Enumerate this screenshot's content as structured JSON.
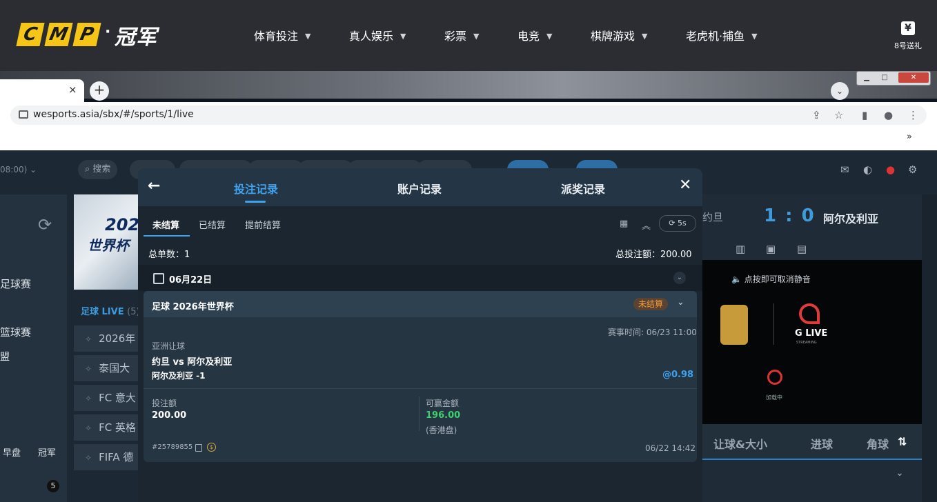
{
  "site": {
    "logo_letters": [
      "C",
      "M",
      "P"
    ],
    "logo_cn": "冠军",
    "nav": [
      "体育投注",
      "真人娱乐",
      "彩票",
      "电竞",
      "棋牌游戏",
      "老虎机·捕鱼"
    ],
    "gift_icon": "yen-gift-icon",
    "gift_label": "8号送礼"
  },
  "browser": {
    "url": "wesports.asia/sbx/#/sports/1/live",
    "tab_close": "×",
    "new_tab": "+",
    "bookmarks_more": "»"
  },
  "page": {
    "timezone": "08:00)",
    "toolbar": [
      "搜索"
    ],
    "left_items": [
      "足球赛",
      "篮球赛",
      "盟"
    ],
    "left_bottom": [
      "早盘",
      "冠军"
    ],
    "left_count": "5",
    "banner_text": [
      "202",
      "世界杯"
    ],
    "live_label": "足球 LIVE",
    "live_count": "(5)",
    "matches": [
      "2026年",
      "泰国大",
      "FC 意大",
      "FC 英格",
      "FIFA 德"
    ],
    "score_home": "约旦",
    "score": "1 : 0",
    "score_away": "阿尔及利亚",
    "mute_text": "点按即可取消静音",
    "brand_text": "G LIVE",
    "brand_sub": "STREAMING",
    "loading": "加载中",
    "bet_tabs": [
      "让球&大小",
      "进球",
      "角球"
    ]
  },
  "modal": {
    "tabs": [
      "投注记录",
      "账户记录",
      "派奖记录"
    ],
    "back_icon": "←",
    "close_icon": "✕",
    "sub_tabs": [
      "未结算",
      "已结算",
      "提前结算"
    ],
    "refresh": "5s",
    "total_orders_label": "总单数：1",
    "total_stake_label": "总投注额：200.00",
    "date": "06月22日",
    "bet": {
      "league": "足球 2026年世界杯",
      "status": "未结算",
      "match_time": "赛事时间: 06/23 11:00",
      "market": "亚洲让球",
      "teams": "约旦 vs 阿尔及利亚",
      "selection": "阿尔及利亚 -1",
      "odds": "@0.98",
      "stake_label": "投注额",
      "stake": "200.00",
      "win_label": "可赢金额",
      "win": "196.00",
      "odds_type": "(香港盘)",
      "ticket_id": "#25789855",
      "placed_time": "06/22 14:42"
    }
  },
  "colors": {
    "accent": "#3ea2ef",
    "win": "#3ecf6f",
    "badge": "#f29a3f",
    "logo": "#f5c518"
  }
}
